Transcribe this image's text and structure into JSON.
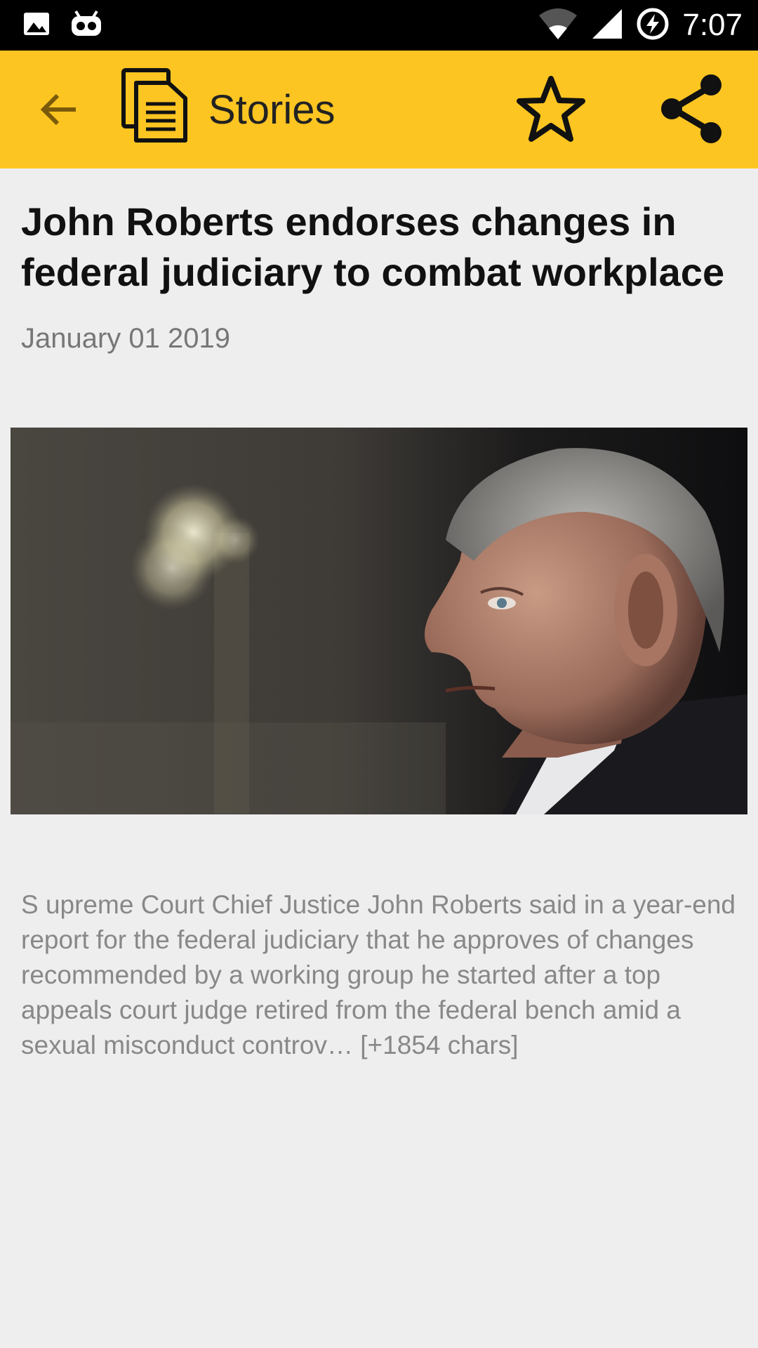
{
  "status_bar": {
    "time": "7:07",
    "icons": [
      "image-icon",
      "android-icon",
      "wifi-icon",
      "signal-icon",
      "battery-charging-icon"
    ]
  },
  "app_bar": {
    "title": "Stories",
    "background": "#fdc521",
    "icons": [
      "back-arrow-icon",
      "document-icon",
      "star-outline-icon",
      "share-icon"
    ]
  },
  "article": {
    "headline": "John Roberts endorses changes in federal judiciary to combat workplace",
    "date": "January 01 2019",
    "body": "S upreme Court Chief Justice John Roberts said in a year-end report for the federal judiciary that he approves of changes recommended by a working group he started after a top appeals court judge retired from the federal bench amid a sexual misconduct controv… [+1854 chars]"
  }
}
